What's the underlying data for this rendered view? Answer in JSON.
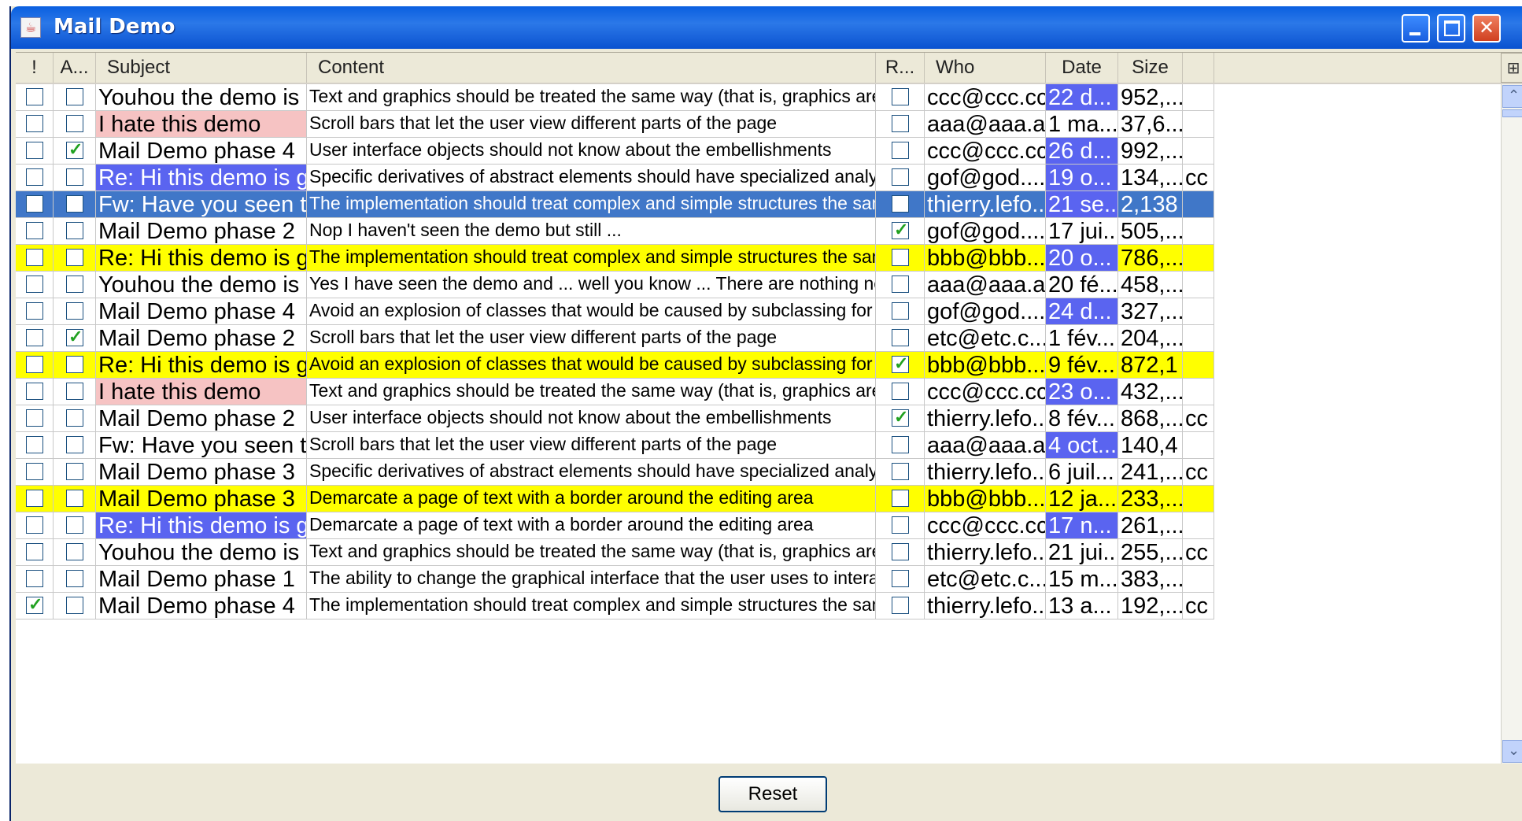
{
  "window": {
    "title": "Mail Demo",
    "app_icon": "java-cup-icon"
  },
  "columns": [
    {
      "key": "flag",
      "label": "!"
    },
    {
      "key": "attach",
      "label": "A..."
    },
    {
      "key": "subject",
      "label": "Subject"
    },
    {
      "key": "content",
      "label": "Content"
    },
    {
      "key": "read",
      "label": "R..."
    },
    {
      "key": "who",
      "label": "Who"
    },
    {
      "key": "date",
      "label": "Date"
    },
    {
      "key": "size",
      "label": "Size"
    },
    {
      "key": "extra",
      "label": ""
    }
  ],
  "colors": {
    "pink": "#f6c3c3",
    "blue": "#5a64f0",
    "selected": "#4077c8",
    "yellow": "#ffff00",
    "check": "#21a121"
  },
  "rows": [
    {
      "flag": false,
      "attach": false,
      "subject": "Youhou the demo is ...",
      "content": "Text and graphics should be treated the same way (that is, graphics aren't a",
      "read": false,
      "who": "ccc@ccc.cc",
      "date": "22 d...",
      "size": "952,...",
      "extra": "",
      "subject_hl": "",
      "date_hl": "blue",
      "row_hl": ""
    },
    {
      "flag": false,
      "attach": false,
      "subject": "I hate this demo",
      "content": "Scroll bars that let the user view different parts of the page",
      "read": false,
      "who": "aaa@aaa.aa",
      "date": "1 ma...",
      "size": "37,6...",
      "extra": "",
      "subject_hl": "pink",
      "date_hl": "",
      "row_hl": ""
    },
    {
      "flag": false,
      "attach": true,
      "subject": "Mail Demo phase 4",
      "content": "User interface objects should not know about the embellishments",
      "read": false,
      "who": "ccc@ccc.cc",
      "date": "26 d...",
      "size": "992,...",
      "extra": "",
      "subject_hl": "",
      "date_hl": "blue",
      "row_hl": ""
    },
    {
      "flag": false,
      "attach": false,
      "subject": "Re: Hi this demo is g...",
      "content": "Specific derivatives of abstract elements should have specialized analytical",
      "read": false,
      "who": "gof@god....",
      "date": "19 o...",
      "size": "134,...",
      "extra": "cc",
      "subject_hl": "blue",
      "date_hl": "blue",
      "row_hl": ""
    },
    {
      "flag": false,
      "attach": false,
      "subject": "Fw: Have you seen t...",
      "content": "The implementation should treat complex and simple structures the same way.",
      "read": false,
      "who": "thierry.lefo...",
      "date": "21 se...",
      "size": "2,138",
      "extra": "",
      "subject_hl": "",
      "date_hl": "blue",
      "row_hl": "selected"
    },
    {
      "flag": false,
      "attach": false,
      "subject": "Mail Demo phase 2",
      "content": "Nop I haven't seen the demo but still ...",
      "read": true,
      "who": "gof@god....",
      "date": "17 jui...",
      "size": "505,...",
      "extra": "",
      "subject_hl": "",
      "date_hl": "",
      "row_hl": ""
    },
    {
      "flag": false,
      "attach": false,
      "subject": "Re: Hi this demo is g...",
      "content": "The implementation should treat complex and simple structures the same way.",
      "read": false,
      "who": "bbb@bbb....",
      "date": "20 o...",
      "size": "786,...",
      "extra": "",
      "subject_hl": "",
      "date_hl": "blue",
      "row_hl": "yellow"
    },
    {
      "flag": false,
      "attach": false,
      "subject": "Youhou the demo is ...",
      "content": "Yes I have seen the demo and ... well you know ... There are nothing new ...",
      "read": false,
      "who": "aaa@aaa.aa",
      "date": "20 fé...",
      "size": "458,...",
      "extra": "",
      "subject_hl": "",
      "date_hl": "",
      "row_hl": ""
    },
    {
      "flag": false,
      "attach": false,
      "subject": "Mail Demo phase 4",
      "content": "Avoid an explosion of classes that would be caused by subclassing for every",
      "read": false,
      "who": "gof@god....",
      "date": "24 d...",
      "size": "327,...",
      "extra": "",
      "subject_hl": "",
      "date_hl": "blue",
      "row_hl": ""
    },
    {
      "flag": false,
      "attach": true,
      "subject": "Mail Demo phase 2",
      "content": "Scroll bars that let the user view different parts of the page",
      "read": false,
      "who": "etc@etc.c...",
      "date": "1 fév...",
      "size": "204,...",
      "extra": "",
      "subject_hl": "",
      "date_hl": "",
      "row_hl": ""
    },
    {
      "flag": false,
      "attach": false,
      "subject": "Re: Hi this demo is g...",
      "content": "Avoid an explosion of classes that would be caused by subclassing for every",
      "read": true,
      "who": "bbb@bbb....",
      "date": "9 fév...",
      "size": "872,1",
      "extra": "",
      "subject_hl": "",
      "date_hl": "",
      "row_hl": "yellow"
    },
    {
      "flag": false,
      "attach": false,
      "subject": "I hate this demo",
      "content": "Text and graphics should be treated the same way (that is, graphics aren't a",
      "read": false,
      "who": "ccc@ccc.cc",
      "date": "23 o...",
      "size": "432,...",
      "extra": "",
      "subject_hl": "pink",
      "date_hl": "blue",
      "row_hl": ""
    },
    {
      "flag": false,
      "attach": false,
      "subject": "Mail Demo phase 2",
      "content": "User interface objects should not know about the embellishments",
      "read": true,
      "who": "thierry.lefo...",
      "date": "8 fév...",
      "size": "868,...",
      "extra": "cc",
      "subject_hl": "",
      "date_hl": "",
      "row_hl": ""
    },
    {
      "flag": false,
      "attach": false,
      "subject": "Fw: Have you seen t...",
      "content": "Scroll bars that let the user view different parts of the page",
      "read": false,
      "who": "aaa@aaa.aa",
      "date": "4 oct...",
      "size": "140,4",
      "extra": "",
      "subject_hl": "",
      "date_hl": "blue",
      "row_hl": ""
    },
    {
      "flag": false,
      "attach": false,
      "subject": "Mail Demo phase 3",
      "content": "Specific derivatives of abstract elements should have specialized analytical",
      "read": false,
      "who": "thierry.lefo...",
      "date": "6 juil...",
      "size": "241,...",
      "extra": "cc",
      "subject_hl": "",
      "date_hl": "",
      "row_hl": ""
    },
    {
      "flag": false,
      "attach": false,
      "subject": "Mail Demo phase 3",
      "content": "Demarcate a page of text with a border around the editing area",
      "read": false,
      "who": "bbb@bbb....",
      "date": "12 ja...",
      "size": "233,...",
      "extra": "",
      "subject_hl": "",
      "date_hl": "",
      "row_hl": "yellow"
    },
    {
      "flag": false,
      "attach": false,
      "subject": "Re: Hi this demo is g...",
      "content": "Demarcate a page of text with a border around the editing area",
      "read": false,
      "who": "ccc@ccc.cc",
      "date": "17 n...",
      "size": "261,...",
      "extra": "",
      "subject_hl": "blue",
      "date_hl": "blue",
      "row_hl": ""
    },
    {
      "flag": false,
      "attach": false,
      "subject": "Youhou the demo is ...",
      "content": "Text and graphics should be treated the same way (that is, graphics aren't a",
      "read": false,
      "who": "thierry.lefo...",
      "date": "21 jui...",
      "size": "255,...",
      "extra": "cc",
      "subject_hl": "",
      "date_hl": "",
      "row_hl": ""
    },
    {
      "flag": false,
      "attach": false,
      "subject": "Mail Demo phase 1",
      "content": "The ability to change the graphical interface that the user uses to interact",
      "read": false,
      "who": "etc@etc.c...",
      "date": "15 m...",
      "size": "383,...",
      "extra": "",
      "subject_hl": "",
      "date_hl": "",
      "row_hl": ""
    },
    {
      "flag": true,
      "attach": false,
      "subject": "Mail Demo phase 4",
      "content": "The implementation should treat complex and simple structures the same way.",
      "read": false,
      "who": "thierry.lefo...",
      "date": "13 a...",
      "size": "192,...",
      "extra": "cc",
      "subject_hl": "",
      "date_hl": "",
      "row_hl": ""
    }
  ],
  "footer": {
    "reset_label": "Reset"
  }
}
